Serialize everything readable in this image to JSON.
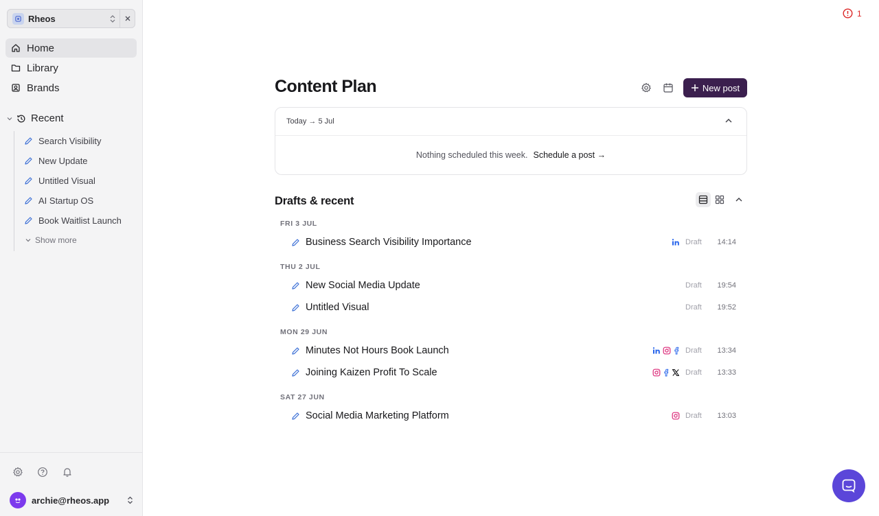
{
  "workspace": {
    "name": "Rheos"
  },
  "nav": [
    {
      "label": "Home",
      "icon": "home-icon",
      "active": true
    },
    {
      "label": "Library",
      "icon": "folder-icon",
      "active": false
    },
    {
      "label": "Brands",
      "icon": "brand-icon",
      "active": false
    }
  ],
  "recent": {
    "label": "Recent",
    "items": [
      "Search Visibility",
      "New Update",
      "Untitled Visual",
      "AI Startup OS",
      "Book Waitlist Launch"
    ],
    "show_more": "Show more"
  },
  "footer": {
    "user_email": "archie@rheos.app"
  },
  "alert": {
    "count": "1",
    "color": "#dc2626"
  },
  "content_plan": {
    "title": "Content Plan",
    "new_post_label": "New post",
    "range_label": "Today → 5 Jul",
    "empty_text": "Nothing scheduled this week.",
    "schedule_link": "Schedule a post →"
  },
  "drafts": {
    "title": "Drafts & recent",
    "groups": [
      {
        "day": "FRI 3 JUL",
        "posts": [
          {
            "title": "Business Search Visibility Importance",
            "platforms": [
              "linkedin-icon"
            ],
            "status": "Draft",
            "time": "14:14"
          }
        ]
      },
      {
        "day": "THU 2 JUL",
        "posts": [
          {
            "title": "New Social Media Update",
            "platforms": [],
            "status": "Draft",
            "time": "19:54"
          },
          {
            "title": "Untitled Visual",
            "platforms": [],
            "status": "Draft",
            "time": "19:52"
          }
        ]
      },
      {
        "day": "MON 29 JUN",
        "posts": [
          {
            "title": "Minutes Not Hours Book Launch",
            "platforms": [
              "linkedin-icon",
              "instagram-icon",
              "facebook-icon"
            ],
            "status": "Draft",
            "time": "13:34"
          },
          {
            "title": "Joining Kaizen Profit To Scale",
            "platforms": [
              "instagram-icon",
              "facebook-icon",
              "x-icon"
            ],
            "status": "Draft",
            "time": "13:33"
          }
        ]
      },
      {
        "day": "SAT 27 JUN",
        "posts": [
          {
            "title": "Social Media Marketing Platform",
            "platforms": [
              "instagram-icon"
            ],
            "status": "Draft",
            "time": "13:03"
          }
        ]
      }
    ]
  },
  "colors": {
    "primary_button": "#3b1f4e",
    "chat_fab": "#5b46d9",
    "pencil": "#3b6fd6"
  }
}
